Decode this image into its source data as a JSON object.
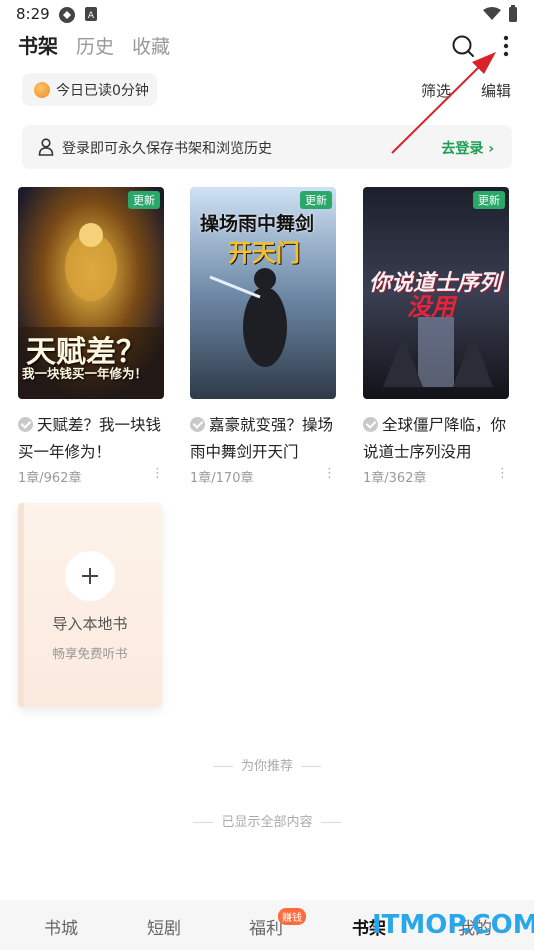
{
  "status_bar": {
    "time": "8:29"
  },
  "header": {
    "tabs": [
      {
        "label": "书架",
        "active": true
      },
      {
        "label": "历史",
        "active": false
      },
      {
        "label": "收藏",
        "active": false
      }
    ],
    "icons": [
      "search-icon",
      "more-vertical-icon"
    ]
  },
  "reading": {
    "today_text": "今日已读0分钟"
  },
  "actions": {
    "filter": "筛选",
    "edit": "编辑"
  },
  "login_banner": {
    "text": "登录即可永久保存书架和浏览历史",
    "button": "去登录"
  },
  "books": [
    {
      "title": "天赋差？我一块钱买一年修为！",
      "progress": "1章/962章",
      "badge": "更新",
      "cover_text": "天赋差？",
      "cover_sub": "我一块钱买一年修为！"
    },
    {
      "title": "嘉豪就变强？操场雨中舞剑开天门",
      "progress": "1章/170章",
      "badge": "更新",
      "cover_text": "操场雨中舞剑",
      "cover_sub": "开天门"
    },
    {
      "title": "全球僵尸降临，你说道士序列没用",
      "progress": "1章/362章",
      "badge": "更新",
      "cover_text": "你说道士序列",
      "cover_sub": "没用"
    }
  ],
  "import_card": {
    "title": "导入本地书",
    "subtitle": "畅享免费听书"
  },
  "recommend_label": "为你推荐",
  "end_label": "已显示全部内容",
  "bottom_nav": {
    "items": [
      {
        "label": "书城",
        "active": false
      },
      {
        "label": "短剧",
        "active": false
      },
      {
        "label": "福利",
        "active": false
      },
      {
        "label": "书架",
        "active": true
      },
      {
        "label": "我的",
        "active": false
      }
    ],
    "badge": "赚钱"
  },
  "watermark": "ITMOP.COM",
  "colors": {
    "accent_green": "#1f9d55",
    "badge_green": "#29a86a",
    "arrow_red": "#d8232a"
  }
}
